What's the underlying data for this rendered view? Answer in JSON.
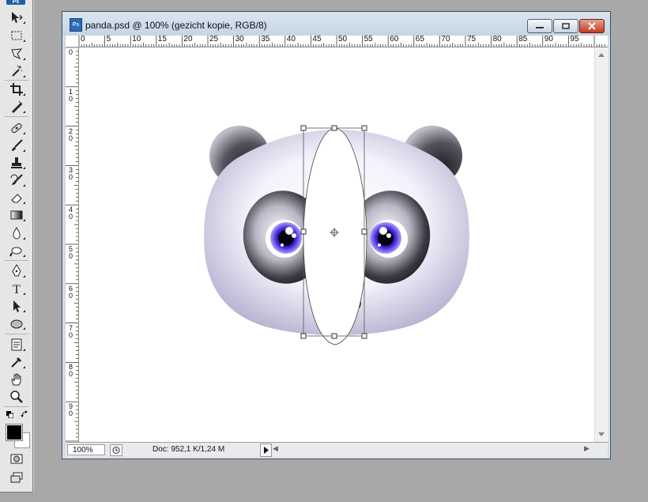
{
  "app": {
    "badge": "Ps"
  },
  "document": {
    "title": "panda.psd @ 100% (gezicht kopie, RGB/8)",
    "zoom": "100%",
    "doc_size": "Doc: 952,1 K/1,24 M"
  },
  "rulers": {
    "horizontal": [
      "0",
      "5",
      "10",
      "15",
      "20",
      "25",
      "30",
      "35",
      "40",
      "45",
      "50",
      "55",
      "60",
      "65",
      "70",
      "75",
      "80",
      "85",
      "90",
      "95"
    ],
    "vertical": [
      "0",
      "1 0",
      "2 0",
      "3 0",
      "4 0",
      "5 0",
      "6 0",
      "7 0",
      "8 0",
      "9 0"
    ]
  },
  "tools": [
    {
      "name": "move-tool-icon"
    },
    {
      "name": "marquee-tool-icon"
    },
    {
      "name": "lasso-tool-icon"
    },
    {
      "name": "magic-wand-tool-icon"
    },
    {
      "name": "crop-tool-icon"
    },
    {
      "name": "slice-tool-icon"
    },
    {
      "name": "healing-brush-tool-icon"
    },
    {
      "name": "brush-tool-icon"
    },
    {
      "name": "clone-stamp-tool-icon"
    },
    {
      "name": "history-brush-tool-icon"
    },
    {
      "name": "eraser-tool-icon"
    },
    {
      "name": "gradient-tool-icon"
    },
    {
      "name": "blur-tool-icon"
    },
    {
      "name": "dodge-tool-icon"
    },
    {
      "name": "pen-tool-icon"
    },
    {
      "name": "type-tool-icon"
    },
    {
      "name": "path-selection-tool-icon"
    },
    {
      "name": "ellipse-tool-icon"
    },
    {
      "name": "notes-tool-icon"
    },
    {
      "name": "eyedropper-tool-icon"
    },
    {
      "name": "hand-tool-icon"
    },
    {
      "name": "zoom-tool-icon"
    }
  ],
  "colors": {
    "foreground": "#000000",
    "background": "#ffffff",
    "panda_shadow": "#3a3a3a",
    "eye_iris": "#3b1fd6"
  }
}
